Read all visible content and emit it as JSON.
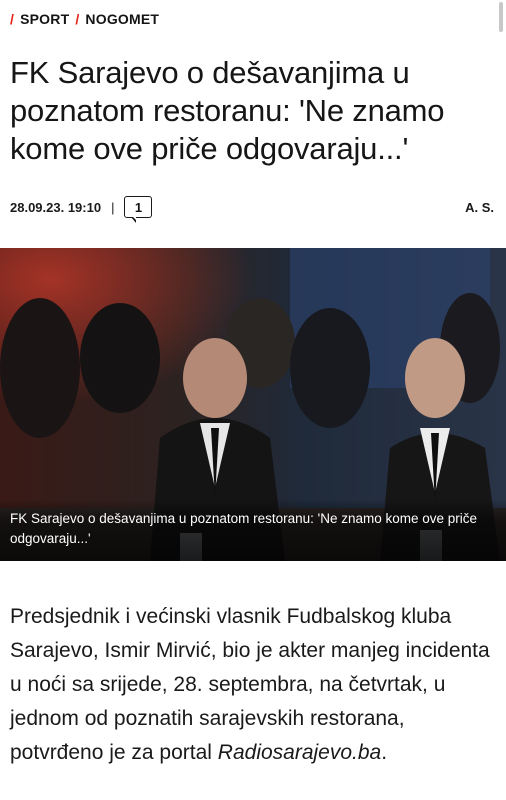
{
  "breadcrumb": {
    "separator": "/",
    "items": [
      "SPORT",
      "NOGOMET"
    ]
  },
  "article": {
    "title": "FK Sarajevo o dešavanjima u poznatom restoranu: 'Ne znamo kome ove priče odgovaraju...'",
    "date": "28.09.23. 19:10",
    "divider": "|",
    "comment_count": "1",
    "author": "A. S.",
    "image_caption": "FK Sarajevo o dešavanjima u poznatom restoranu: 'Ne znamo kome ove priče odgovaraju...'",
    "body_main": "Predsjednik i većinski vlasnik Fudbalskog kluba Sarajevo, Ismir Mirvić, bio je akter manjeg incidenta u noći sa srijede, 28. septembra, na četvrtak, u jednom od poznatih sarajevskih restorana, potvrđeno je za portal ",
    "body_link": "Radiosarajevo.ba",
    "body_end": "."
  },
  "icons": {
    "comment": "comment-bubble-icon"
  },
  "colors": {
    "accent": "#e2231a",
    "text": "#141414",
    "background": "#ffffff"
  }
}
